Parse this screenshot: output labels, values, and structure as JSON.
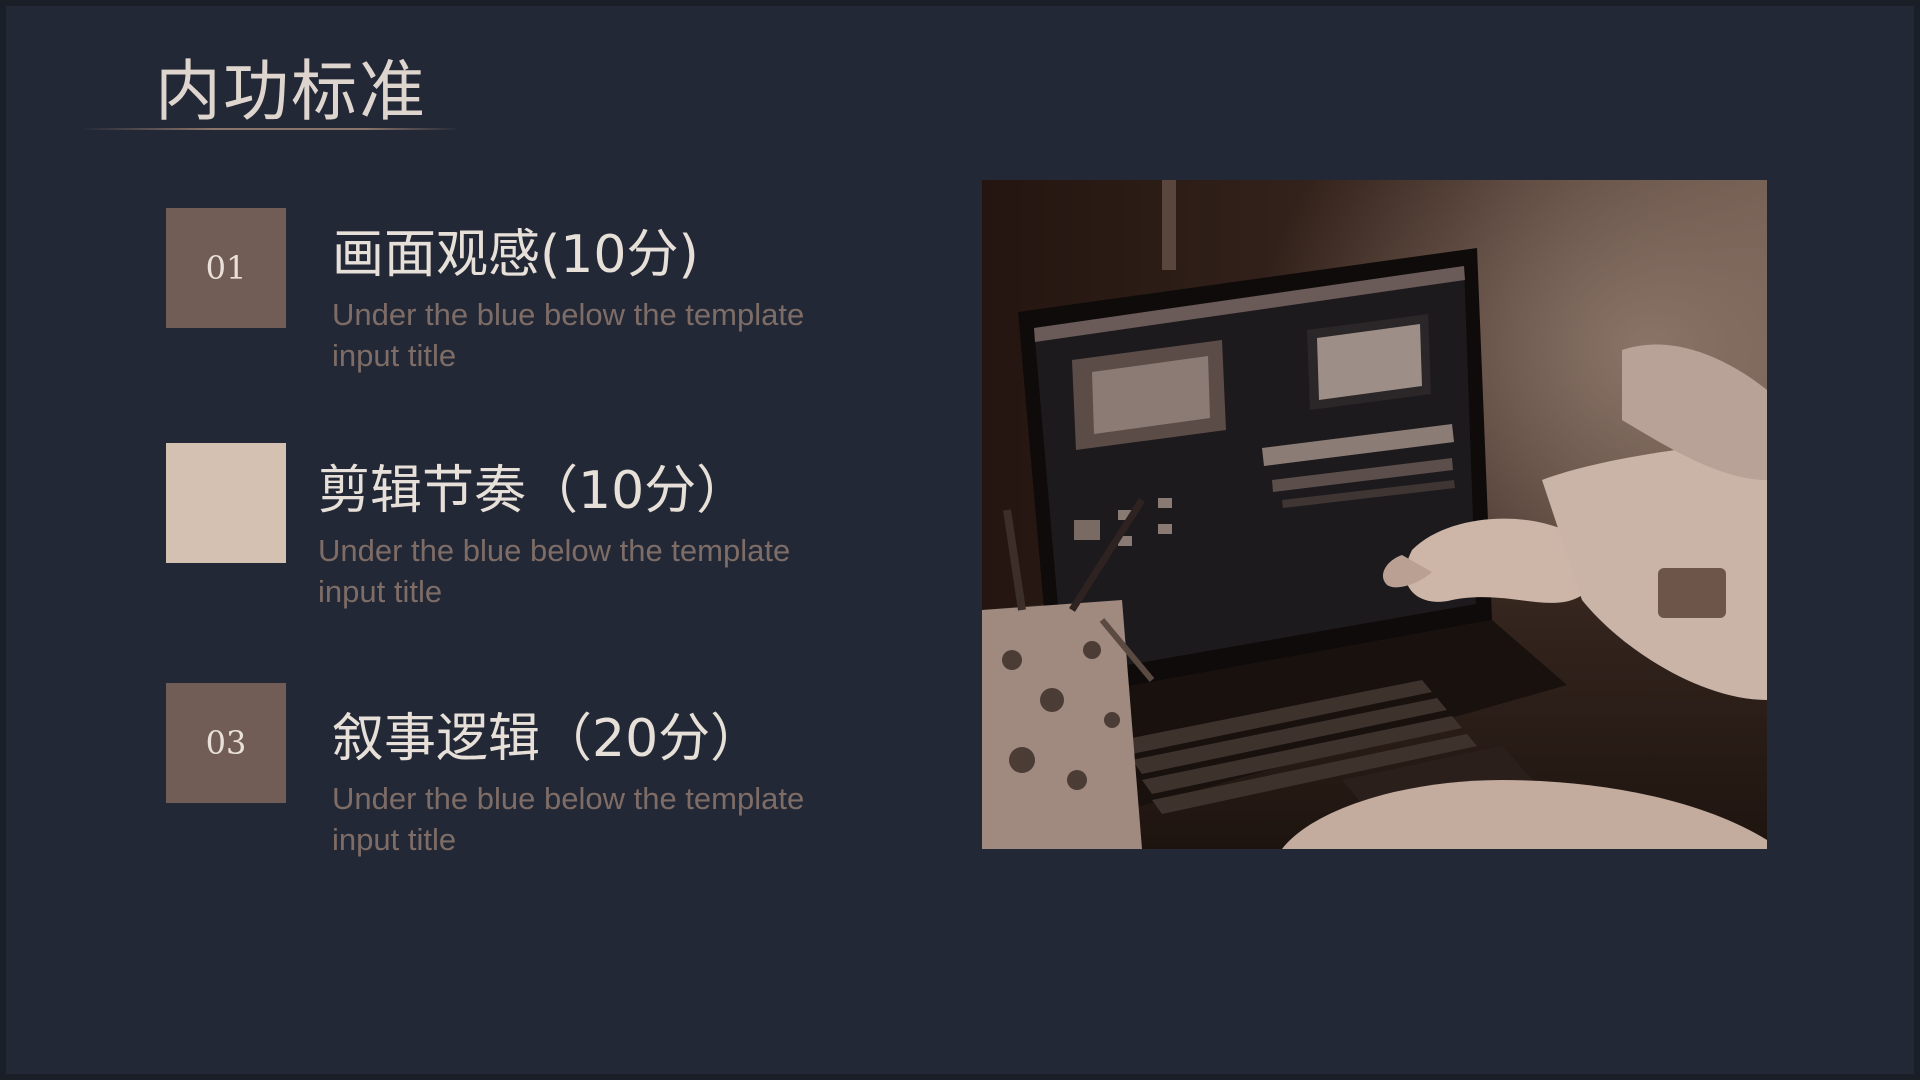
{
  "slide": {
    "title": "内功标准",
    "items": [
      {
        "number": "01",
        "title": "画面观感(10分)",
        "desc": "Under the blue below the template input title"
      },
      {
        "number": "",
        "title": "剪辑节奏（10分）",
        "desc": "Under the blue below the template input title"
      },
      {
        "number": "03",
        "title": "叙事逻辑（20分）",
        "desc": "Under the blue below the template input title"
      }
    ]
  },
  "colors": {
    "background": "#232836",
    "accent_dark": "#715d55",
    "accent_light": "#d4c1b2",
    "text_light": "#e7e0d9",
    "text_muted": "#7e6c66"
  },
  "photo": {
    "subject": "laptop-video-editing-photo"
  }
}
